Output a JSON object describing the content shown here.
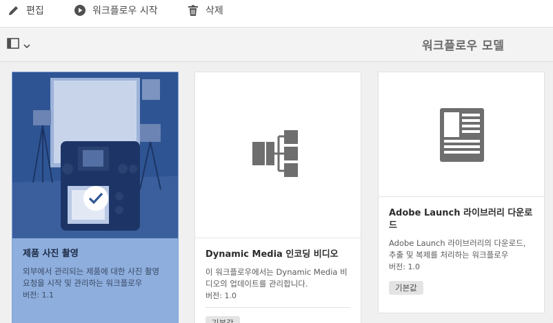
{
  "toolbar": {
    "edit_label": "편집",
    "start_label": "워크플로우 시작",
    "delete_label": "삭제"
  },
  "header": {
    "title": "워크플로우 모델"
  },
  "cards": [
    {
      "title": "제품 사진 촬영",
      "description": "외부에서 관리되는 제품에 대한 사진 촬영 요청을 시작 및 관리하는 워크플로우",
      "version": "버전: 1.1",
      "selected": true,
      "thumbnail": "camera-studio-photo"
    },
    {
      "title": "Dynamic Media 인코딩 비디오",
      "description": "이 워크플로우에서는 Dynamic Media 비디오의 업데이트를 관리합니다.",
      "version": "버전: 1.0",
      "badge": "기본값",
      "thumbnail": "workflow-model-icon"
    },
    {
      "title": "Adobe Launch 라이브러리 다운로드",
      "description": "Adobe Launch 라이브러리의 다운로드, 추출 및 복제를 처리하는 워크플로우",
      "version": "버전: 1.0",
      "badge": "기본값",
      "thumbnail": "document-icon"
    }
  ],
  "colors": {
    "selected_card": "#8eaedd",
    "selected_thumb": "#2f5493",
    "icon_gray": "#6e6e6e"
  }
}
